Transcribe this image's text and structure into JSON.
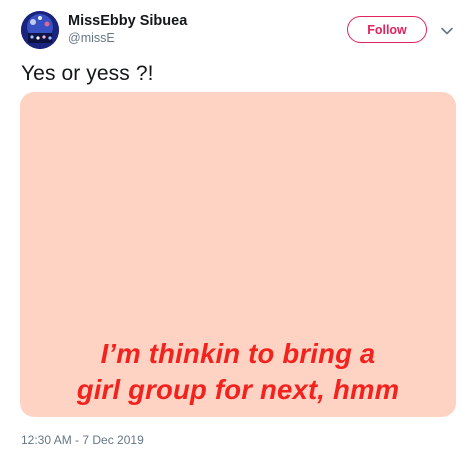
{
  "tweet": {
    "author": {
      "display_name": "MissEbby Sibuea",
      "handle": "@missE"
    },
    "follow_label": "Follow",
    "text": "Yes or yess ?!",
    "media": {
      "background_color": "#ffd3c3",
      "caption_color": "#f2231e",
      "caption_lines": [
        "I’m thinkin to bring a",
        "girl group for next, hmm"
      ]
    },
    "timestamp": "12:30 AM - 7 Dec 2019"
  },
  "colors": {
    "follow_accent": "#e0245e",
    "secondary_text": "#657786",
    "primary_text": "#14171a"
  },
  "icons": {
    "menu": "chevron-down-icon",
    "avatar": "avatar"
  }
}
